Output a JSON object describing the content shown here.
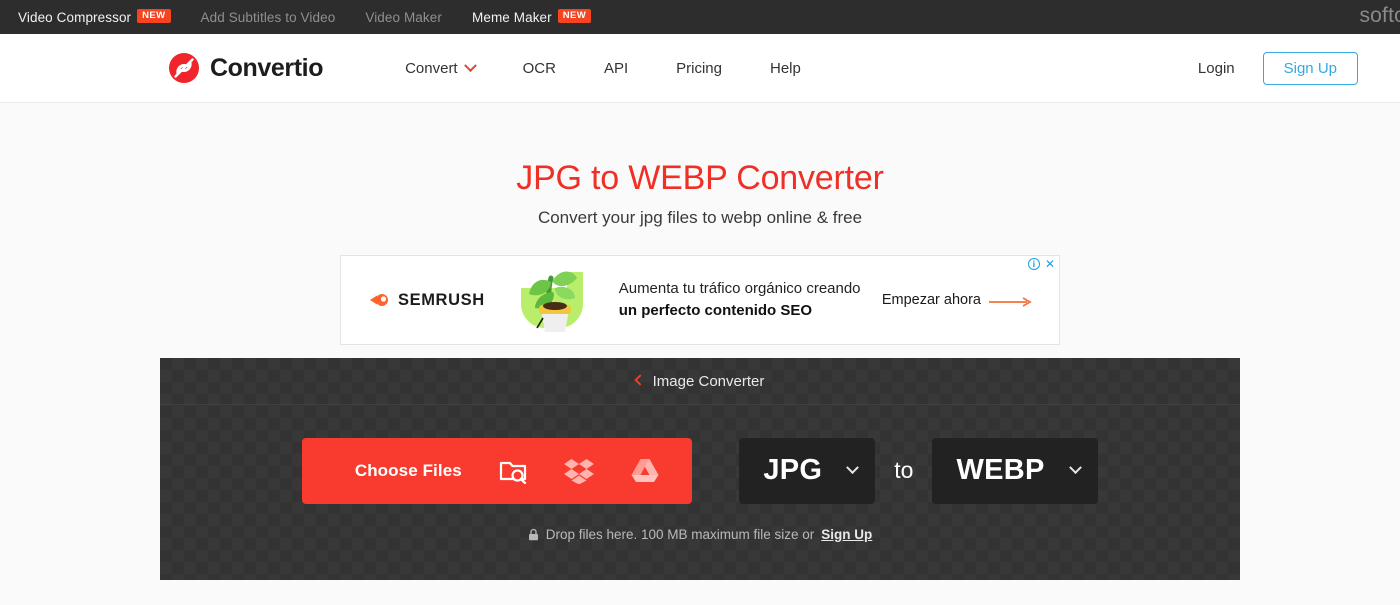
{
  "topbar": {
    "items": [
      {
        "label": "Video Compressor",
        "badge": "NEW",
        "state": "active"
      },
      {
        "label": "Add Subtitles to Video",
        "badge": "",
        "state": "dim"
      },
      {
        "label": "Video Maker",
        "badge": "",
        "state": "dim"
      },
      {
        "label": "Meme Maker",
        "badge": "NEW",
        "state": "active"
      }
    ],
    "brand_right": "softo"
  },
  "header": {
    "brand_name": "Convertio",
    "nav": [
      {
        "label": "Convert",
        "has_caret": true
      },
      {
        "label": "OCR",
        "has_caret": false
      },
      {
        "label": "API",
        "has_caret": false
      },
      {
        "label": "Pricing",
        "has_caret": false
      },
      {
        "label": "Help",
        "has_caret": false
      }
    ],
    "login_label": "Login",
    "signup_label": "Sign Up",
    "accent_blue": "#35a8e0",
    "accent_red": "#e8402a"
  },
  "hero": {
    "title": "JPG to WEBP Converter",
    "subtitle": "Convert your jpg files to webp online & free",
    "title_color": "#f03026"
  },
  "ad": {
    "advertiser": "SEMRUSH",
    "line1": "Aumenta tu tráfico orgánico creando",
    "line2": "un perfecto contenido SEO",
    "cta": "Empezar ahora",
    "info_glyph": "i",
    "close_glyph": "✕"
  },
  "dropzone": {
    "breadcrumb_label": "Image Converter",
    "choose_files_label": "Choose Files",
    "sources": [
      "computer-folder-icon",
      "dropbox-icon",
      "google-drive-icon"
    ],
    "format_from": "JPG",
    "format_to": "WEBP",
    "to_word": "to",
    "note_prefix": "Drop files here. 100 MB maximum file size or",
    "note_link": "Sign Up",
    "button_color": "#f93a2f"
  }
}
